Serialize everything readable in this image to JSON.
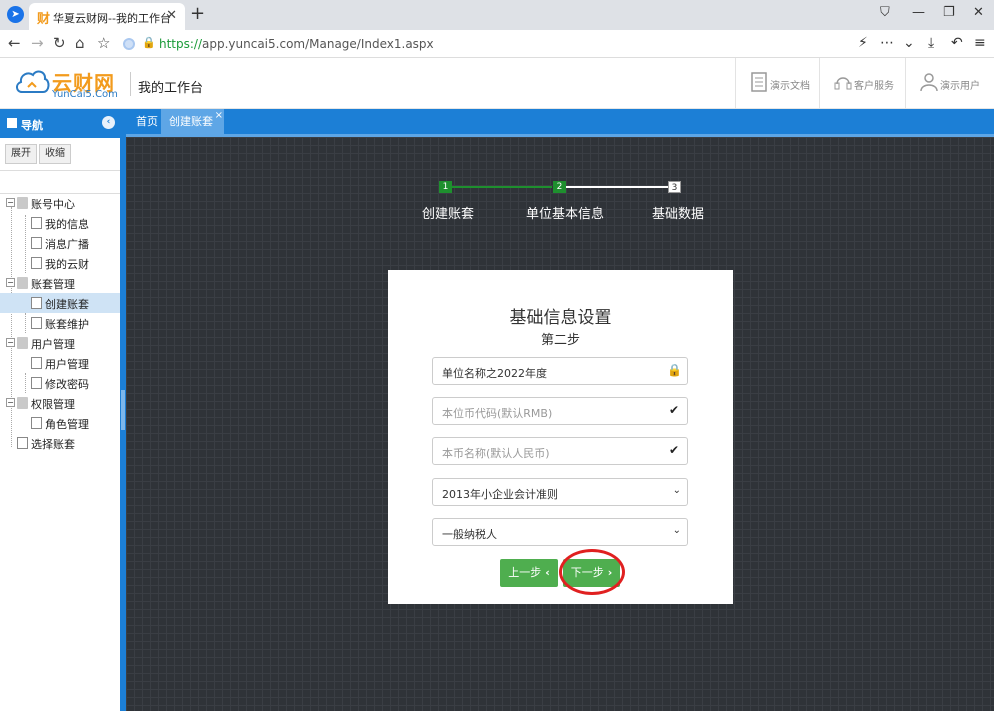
{
  "browser": {
    "tab_title": "华夏云财网--我的工作台",
    "tab_favicon": "财",
    "url_scheme": "https://",
    "url_rest": "app.yuncai5.com/Manage/Index1.aspx",
    "icons": [
      "back-icon",
      "forward-icon",
      "reload-icon",
      "home-icon",
      "bookmark-star-icon",
      "lightning-icon",
      "more-icon",
      "chevron-down-icon",
      "download-icon",
      "undo-icon",
      "menu-icon"
    ]
  },
  "header": {
    "logo_cn": "云财网",
    "logo_en": "YunCai5.Com",
    "title": "我的工作台",
    "links": [
      "演示文档",
      "客户服务",
      "演示用户"
    ]
  },
  "sidebar": {
    "title": "导航",
    "expand_label": "展开",
    "collapse_label": "收缩",
    "tree": [
      {
        "label": "账号中心",
        "level": 0
      },
      {
        "label": "我的信息",
        "level": 1
      },
      {
        "label": "消息广播",
        "level": 1
      },
      {
        "label": "我的云财",
        "level": 1
      },
      {
        "label": "账套管理",
        "level": 0
      },
      {
        "label": "创建账套",
        "level": 1,
        "selected": true
      },
      {
        "label": "账套维护",
        "level": 1
      },
      {
        "label": "用户管理",
        "level": 0
      },
      {
        "label": "用户管理",
        "level": 1
      },
      {
        "label": "修改密码",
        "level": 1
      },
      {
        "label": "权限管理",
        "level": 0
      },
      {
        "label": "角色管理",
        "level": 1
      },
      {
        "label": "选择账套",
        "level": 0
      }
    ]
  },
  "content_tabs": [
    {
      "label": "首页",
      "active": false
    },
    {
      "label": "创建账套",
      "active": true
    }
  ],
  "steps": [
    {
      "number": "1",
      "label": "创建账套",
      "status": "done"
    },
    {
      "number": "2",
      "label": "单位基本信息",
      "status": "done"
    },
    {
      "number": "3",
      "label": "基础数据",
      "status": "todo"
    }
  ],
  "form": {
    "title": "基础信息设置",
    "subtitle": "第二步",
    "company_name_value": "单位名称之2022年度",
    "currency_code_placeholder": "本位币代码(默认RMB)",
    "currency_name_placeholder": "本币名称(默认人民币)",
    "accounting_standard_selected": "2013年小企业会计准则",
    "taxpayer_type_selected": "一般纳税人",
    "prev_label": "上一步",
    "next_label": "下一步"
  },
  "colors": {
    "primary_blue": "#1c7fd6",
    "success_green": "#4fae4f",
    "step_done_green": "#1e8f2e",
    "highlight_red": "#e02020",
    "logo_orange": "#f29b1d"
  }
}
